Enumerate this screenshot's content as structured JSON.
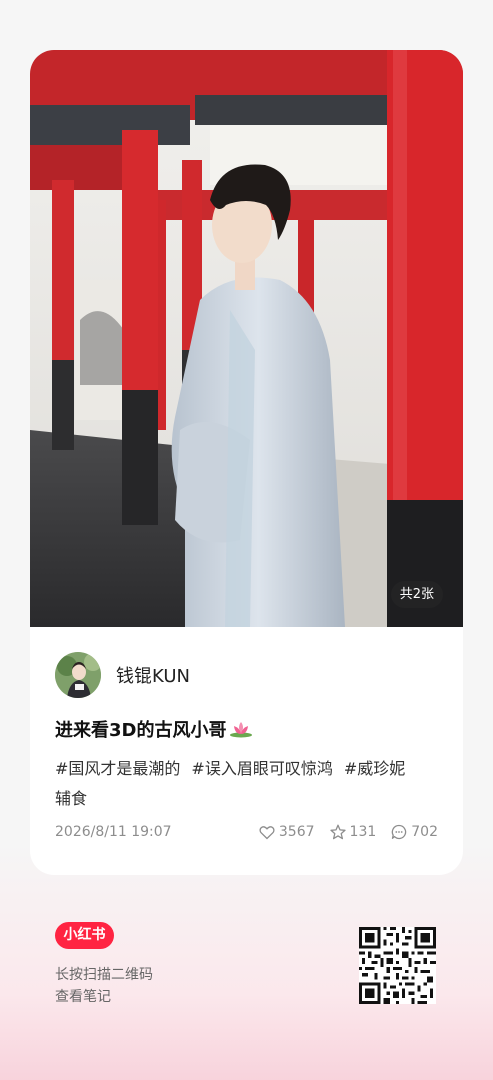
{
  "post": {
    "page_count": "共2张",
    "author_name": "钱锟KUN",
    "title": "进来看3D的古风小哥",
    "title_emoji_icon": "lotus-icon",
    "tags": [
      "#国风才是最潮的",
      "#误入眉眼可叹惊鸿",
      "#威珍妮",
      "辅食"
    ],
    "date": "2026/8/11 19:07",
    "likes": "3567",
    "collects": "131",
    "comments": "702"
  },
  "footer": {
    "brand_label": "小红书",
    "scan_line1": "长按扫描二维码",
    "scan_line2": "查看笔记"
  },
  "colors": {
    "brand": "#ff2442",
    "pillar_red": "#d8262b",
    "meta_gray": "#8d8d8d"
  }
}
